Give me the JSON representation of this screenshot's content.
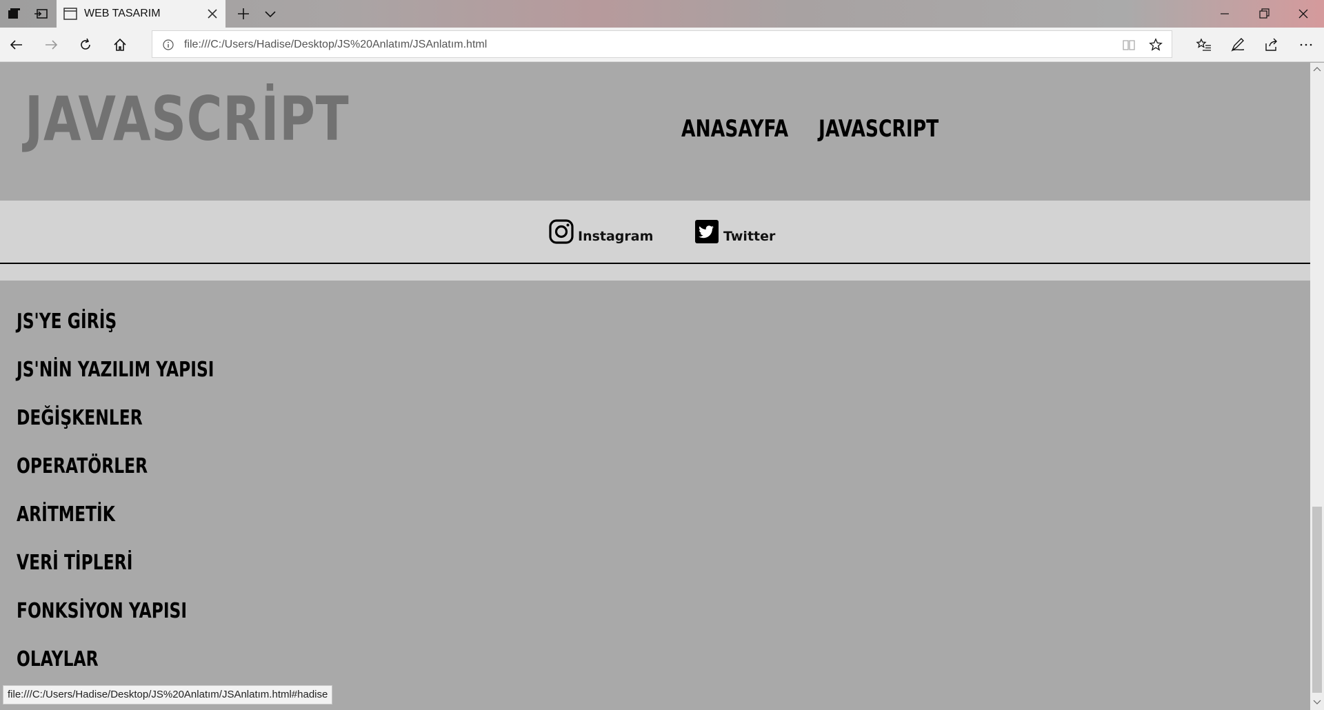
{
  "browser": {
    "tab_title": "WEB TASARIM",
    "address": "file:///C:/Users/Hadise/Desktop/JS%20Anlatım/JSAnlatım.html",
    "status_url": "file:///C:/Users/Hadise/Desktop/JS%20Anlatım/JSAnlatım.html#hadise"
  },
  "site": {
    "logo": "JAVASCRİPT",
    "nav": [
      "ANASAYFA",
      "JAVASCRIPT"
    ],
    "social": [
      "Instagram",
      "Twitter"
    ],
    "menu": [
      "JS'YE GİRİŞ",
      "JS'NİN YAZILIM YAPISI",
      "DEĞİŞKENLER",
      "OPERATÖRLER",
      "ARİTMETİK",
      "VERİ TİPLERİ",
      "FONKSİYON YAPISI",
      "OLAYLAR"
    ]
  },
  "colors": {
    "page_bg": "#a9a9a9",
    "social_bg": "#d3d3d3",
    "logo": "#727272"
  }
}
